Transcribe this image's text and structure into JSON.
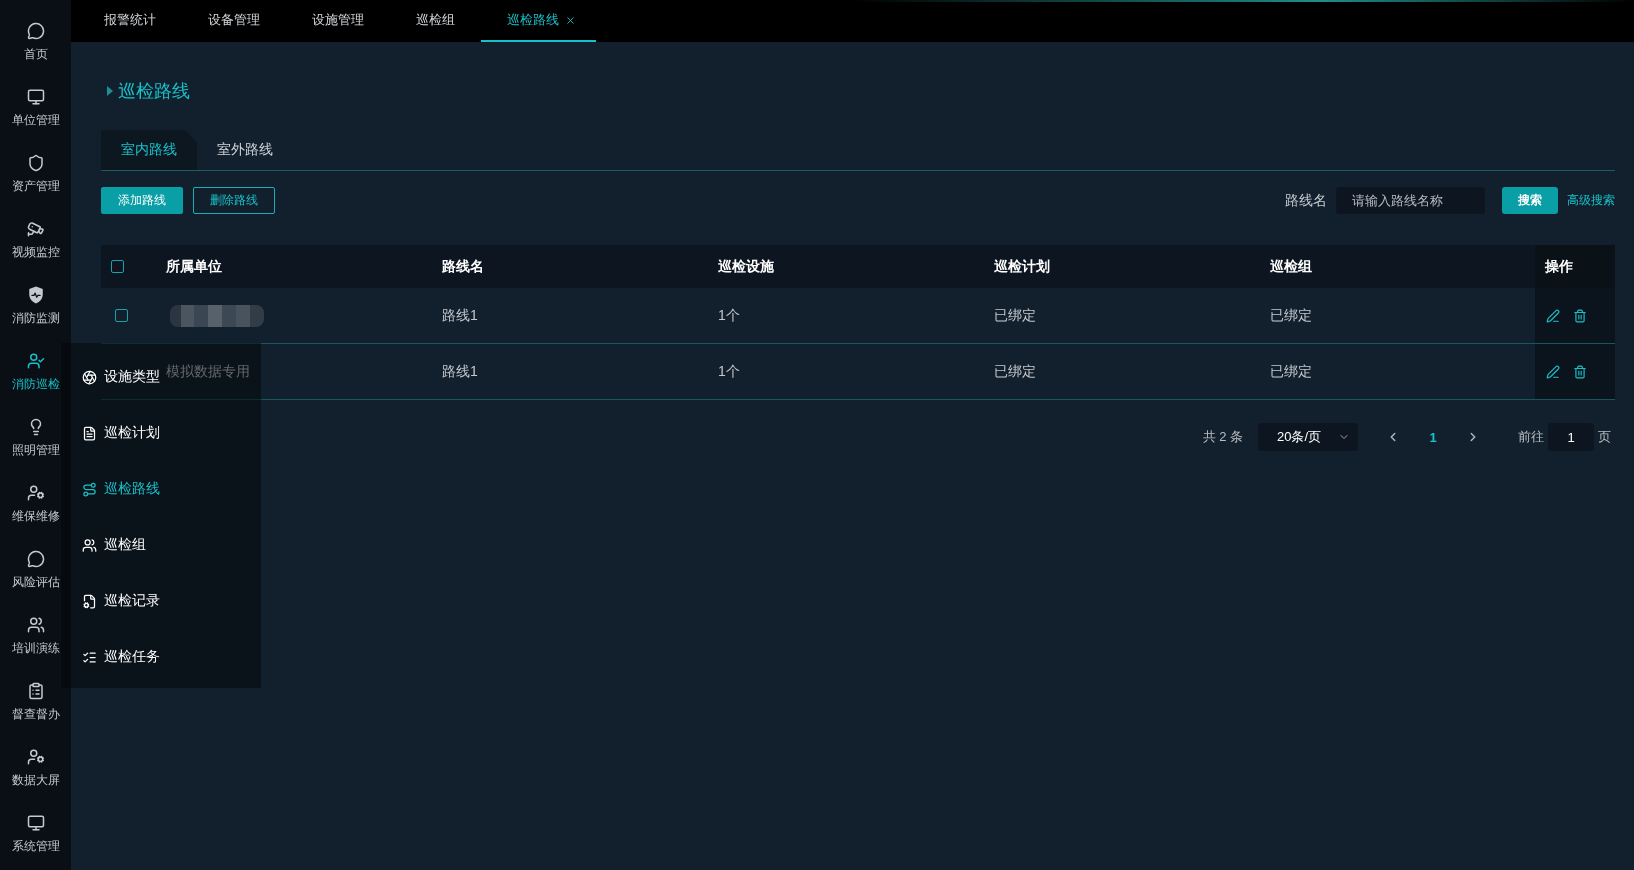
{
  "sidebar": {
    "items": [
      {
        "label": "首页",
        "selected": false
      },
      {
        "label": "单位管理",
        "selected": false
      },
      {
        "label": "资产管理",
        "selected": false
      },
      {
        "label": "视频监控",
        "selected": false
      },
      {
        "label": "消防监测",
        "selected": false
      },
      {
        "label": "消防巡检",
        "selected": true
      },
      {
        "label": "照明管理",
        "selected": false
      },
      {
        "label": "维保维修",
        "selected": false
      },
      {
        "label": "风险评估",
        "selected": false
      },
      {
        "label": "培训演练",
        "selected": false
      },
      {
        "label": "督查督办",
        "selected": false
      },
      {
        "label": "数据大屏",
        "selected": false
      },
      {
        "label": "系统管理",
        "selected": false
      }
    ]
  },
  "submenu": {
    "items": [
      {
        "label": "设施类型",
        "selected": false
      },
      {
        "label": "巡检计划",
        "selected": false
      },
      {
        "label": "巡检路线",
        "selected": true
      },
      {
        "label": "巡检组",
        "selected": false
      },
      {
        "label": "巡检记录",
        "selected": false
      },
      {
        "label": "巡检任务",
        "selected": false
      }
    ]
  },
  "tabs": [
    {
      "label": "报警统计",
      "selected": false,
      "closable": false
    },
    {
      "label": "设备管理",
      "selected": false,
      "closable": false
    },
    {
      "label": "设施管理",
      "selected": false,
      "closable": false
    },
    {
      "label": "巡检组",
      "selected": false,
      "closable": false
    },
    {
      "label": "巡检路线",
      "selected": true,
      "closable": true
    }
  ],
  "page_title": "巡检路线",
  "route_tabs": [
    {
      "label": "室内路线",
      "selected": true
    },
    {
      "label": "室外路线",
      "selected": false
    }
  ],
  "actions": [
    {
      "label": "添加路线",
      "kind": "primary"
    },
    {
      "label": "删除路线",
      "kind": "outline"
    }
  ],
  "search": {
    "label": "路线名",
    "placeholder": "请输入路线名称",
    "button": "搜索",
    "advanced_link": "高级搜索"
  },
  "table": {
    "all_checked": false,
    "columns": [
      "所属单位",
      "路线名",
      "巡检设施",
      "巡检计划",
      "巡检组",
      "操作"
    ],
    "rows": [
      {
        "checked": false,
        "unit_redacted": true,
        "cells": [
          "",
          "路线1",
          "1个",
          "已绑定",
          "已绑定"
        ]
      },
      {
        "unit_redacted": false,
        "cells": [
          "模拟数据专用",
          "路线1",
          "1个",
          "已绑定",
          "已绑定"
        ]
      }
    ]
  },
  "pagination": {
    "total": "共 2 条",
    "page_size": "20条/页",
    "pages": [
      {
        "label": "1",
        "selected": true
      }
    ],
    "goto_label": "前往",
    "goto_value": "1",
    "goto_suffix": "页"
  }
}
